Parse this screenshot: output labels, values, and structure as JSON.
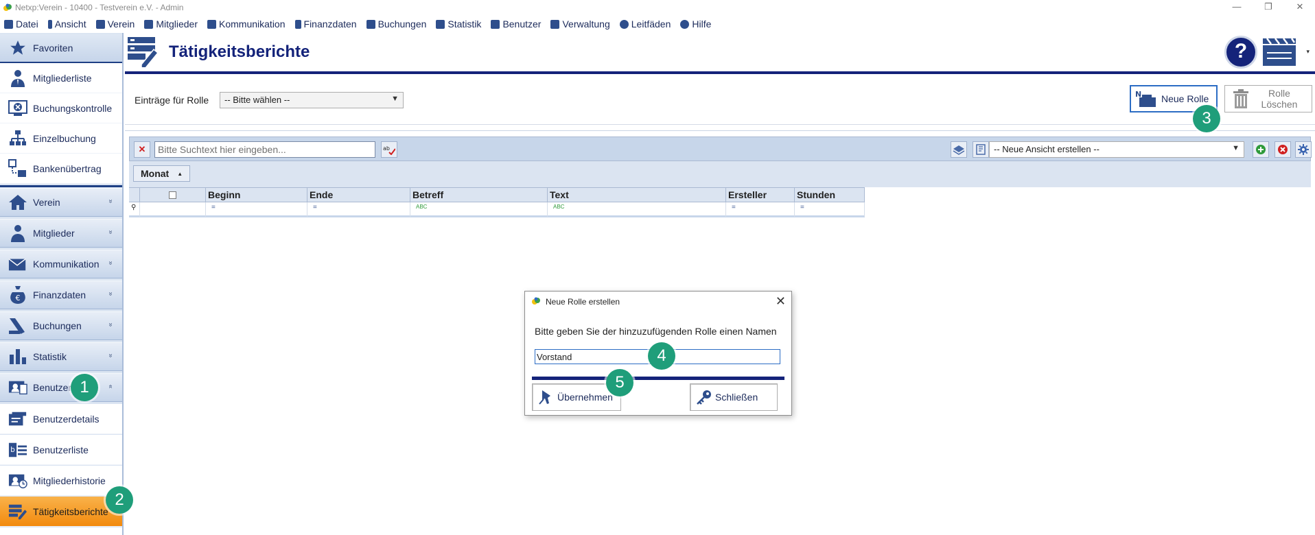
{
  "window": {
    "title": "Netxp:Verein - 10400 - Testverein e.V. - Admin",
    "controls": {
      "minimize": "—",
      "restore": "❐",
      "close": "✕"
    }
  },
  "menubar": {
    "items": [
      "Datei",
      "Ansicht",
      "Verein",
      "Mitglieder",
      "Kommunikation",
      "Finanzdaten",
      "Buchungen",
      "Statistik",
      "Benutzer",
      "Verwaltung",
      "Leitfäden",
      "Hilfe"
    ]
  },
  "sidebar": {
    "favorites": "Favoriten",
    "quicklinks": [
      "Mitgliederliste",
      "Buchungskontrolle",
      "Einzelbuchung",
      "Bankenübertrag"
    ],
    "groups": [
      "Verein",
      "Mitglieder",
      "Kommunikation",
      "Finanzdaten",
      "Buchungen",
      "Statistik",
      "Benutzer"
    ],
    "group_chevron": "»",
    "group_chevron_open": "«",
    "benutzer_links": [
      "Benutzerdetails",
      "Benutzerliste",
      "Mitgliederhistorie",
      "Tätigkeitsberichte"
    ],
    "active_item": "Tätigkeitsberichte"
  },
  "header": {
    "title": "Tätigkeitsberichte",
    "help_symbol": "?",
    "caret": "▾"
  },
  "rolebar": {
    "label": "Einträge für Rolle",
    "select_value": "-- Bitte wählen --",
    "new_role": "Neue Rolle",
    "delete_role_line1": "Rolle",
    "delete_role_line2": "Löschen"
  },
  "toolbar": {
    "search_placeholder": "Bitte Suchtext hier eingeben...",
    "view_select": "-- Neue Ansicht erstellen --"
  },
  "grid": {
    "group_by": "Monat",
    "group_sort": "▲",
    "columns": [
      "Beginn",
      "Ende",
      "Betreff",
      "Text",
      "Ersteller",
      "Stunden"
    ],
    "filter_symbols": [
      "=",
      "=",
      "ABC",
      "ABC",
      "=",
      "="
    ]
  },
  "dialog": {
    "title": "Neue Rolle erstellen",
    "prompt": "Bitte geben Sie der hinzuzufügenden Rolle einen Namen",
    "input_value": "Vorstand",
    "ok": "Übernehmen",
    "close": "Schließen"
  },
  "markers": [
    "1",
    "2",
    "3",
    "4",
    "5"
  ],
  "colors": {
    "brand_navy": "#14237a",
    "accent_orange": "#f28a0e",
    "marker_green": "#1f9e7a",
    "sidebar_bg": "#dbe5f2"
  }
}
